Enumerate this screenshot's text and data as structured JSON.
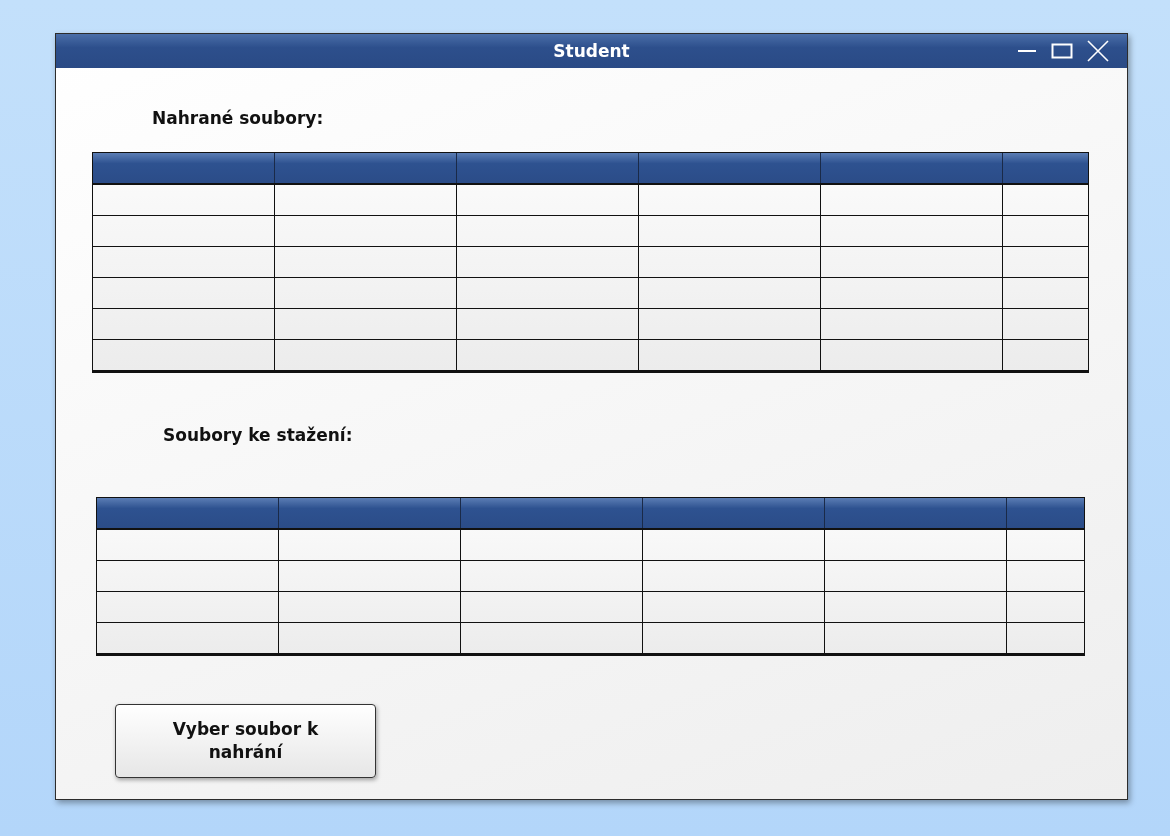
{
  "window": {
    "title": "Student"
  },
  "tables": [
    {
      "title": "Nahrané soubory:"
    },
    {
      "title": "Soubory ke stažení:"
    }
  ],
  "buttons": [
    {
      "label": "Vyber soubor k nahrání"
    }
  ]
}
